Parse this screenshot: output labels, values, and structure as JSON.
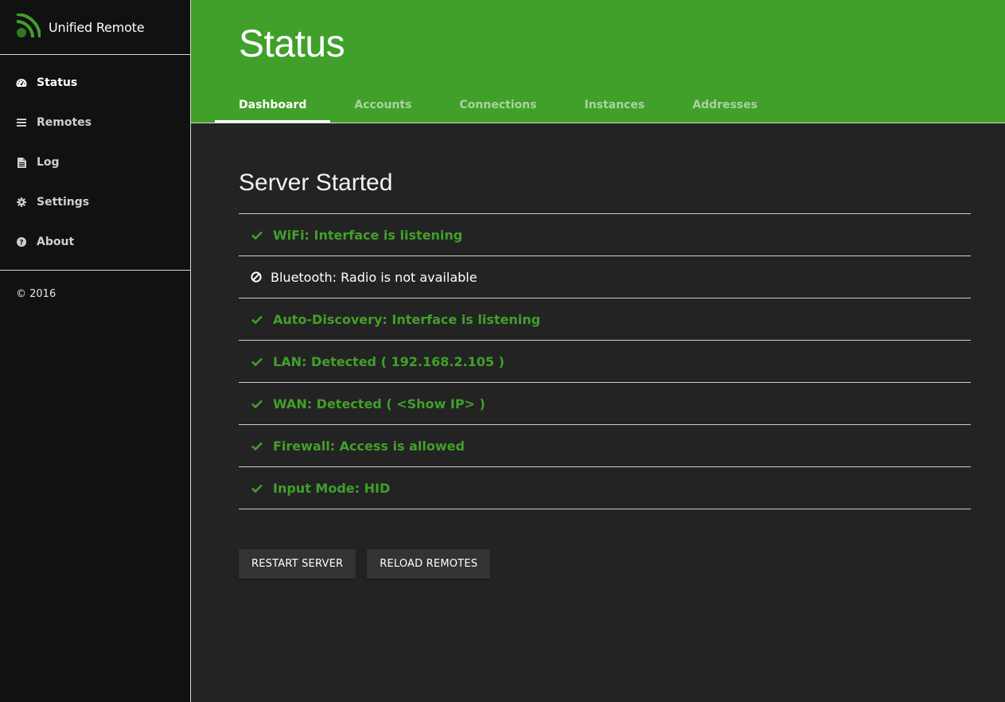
{
  "app": {
    "title": "Unified Remote",
    "logo_icon": "signal-logo-icon",
    "brand_color": "#41a02a"
  },
  "sidebar": {
    "items": [
      {
        "label": "Status",
        "icon": "dashboard-icon",
        "active": true
      },
      {
        "label": "Remotes",
        "icon": "menu-bars-icon",
        "active": false
      },
      {
        "label": "Log",
        "icon": "document-icon",
        "active": false
      },
      {
        "label": "Settings",
        "icon": "gear-icon",
        "active": false
      },
      {
        "label": "About",
        "icon": "question-circle-icon",
        "active": false
      }
    ],
    "copyright": "© 2016"
  },
  "header": {
    "title": "Status",
    "tabs": [
      {
        "label": "Dashboard",
        "active": true
      },
      {
        "label": "Accounts",
        "active": false
      },
      {
        "label": "Connections",
        "active": false
      },
      {
        "label": "Instances",
        "active": false
      },
      {
        "label": "Addresses",
        "active": false
      }
    ]
  },
  "main": {
    "section_title": "Server Started",
    "status_items": [
      {
        "text": "WiFi: Interface is listening",
        "state": "ok",
        "icon": "check-icon"
      },
      {
        "text": "Bluetooth: Radio is not available",
        "state": "unavailable",
        "icon": "ban-icon"
      },
      {
        "text": "Auto-Discovery: Interface is listening",
        "state": "ok",
        "icon": "check-icon"
      },
      {
        "text": "LAN: Detected ( 192.168.2.105 )",
        "state": "ok",
        "icon": "check-icon"
      },
      {
        "text": "WAN: Detected ( <Show IP> )",
        "state": "ok",
        "icon": "check-icon"
      },
      {
        "text": "Firewall: Access is allowed",
        "state": "ok",
        "icon": "check-icon"
      },
      {
        "text": "Input Mode: HID",
        "state": "ok",
        "icon": "check-icon"
      }
    ],
    "buttons": {
      "restart": "RESTART SERVER",
      "reload": "RELOAD REMOTES"
    }
  }
}
